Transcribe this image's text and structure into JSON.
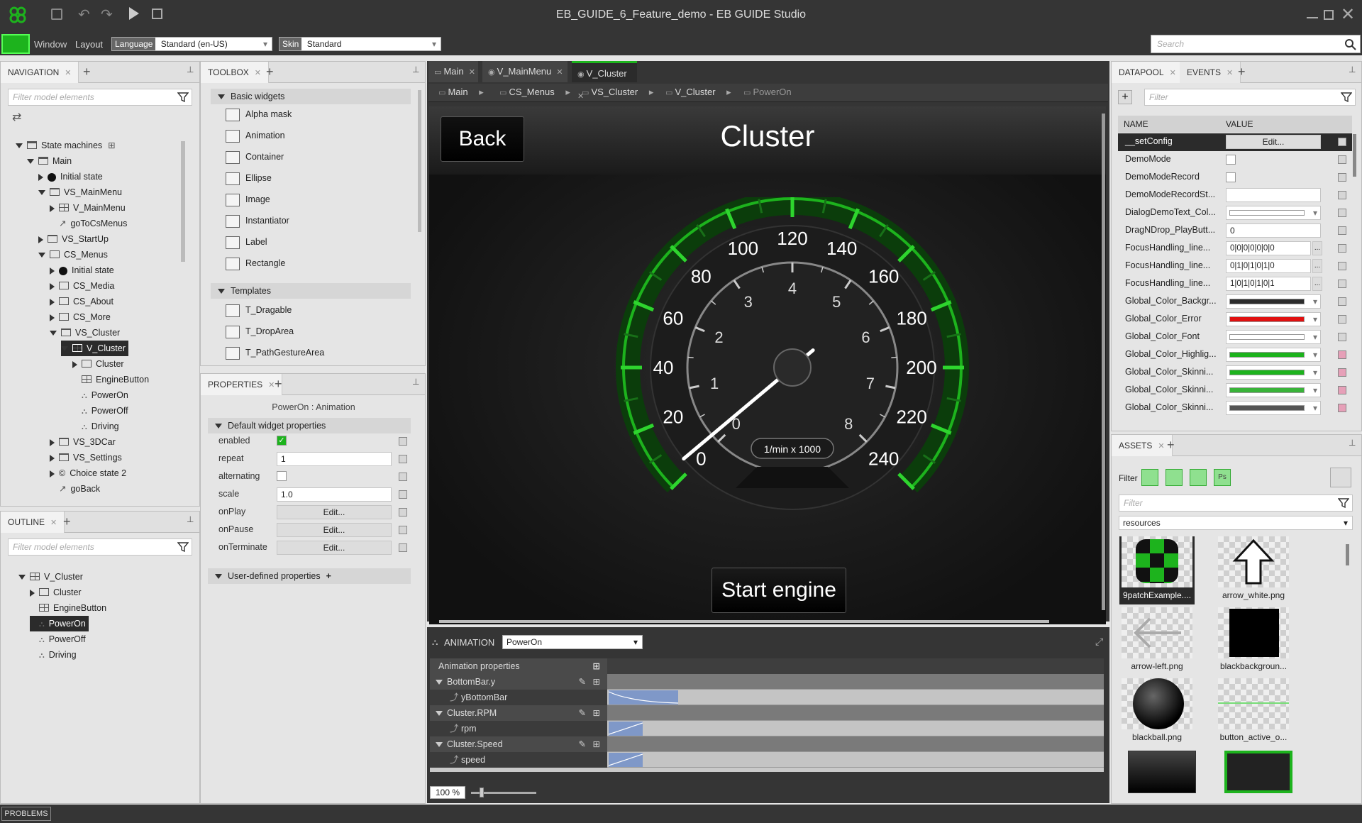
{
  "window": {
    "title": "EB_GUIDE_6_Feature_demo - EB GUIDE Studio"
  },
  "menubar": {
    "window": "Window",
    "layout": "Layout",
    "language_label": "Language",
    "language_value": "Standard (en-US)",
    "skin_label": "Skin",
    "skin_value": "Standard",
    "search_placeholder": "Search"
  },
  "navigation": {
    "tab": "NAVIGATION",
    "filter_placeholder": "Filter model elements",
    "items": [
      {
        "label": "State machines",
        "indent": 0,
        "arrow": "down",
        "icon": "statemachine"
      },
      {
        "label": "Main",
        "indent": 1,
        "arrow": "down",
        "icon": "statemachine"
      },
      {
        "label": "Initial state",
        "indent": 2,
        "arrow": "right",
        "icon": "dot"
      },
      {
        "label": "VS_MainMenu",
        "indent": 2,
        "arrow": "down",
        "icon": "view"
      },
      {
        "label": "V_MainMenu",
        "indent": 3,
        "arrow": "right",
        "icon": "grid"
      },
      {
        "label": "goToCsMenus",
        "indent": 3,
        "arrow": "none",
        "icon": "transition"
      },
      {
        "label": "VS_StartUp",
        "indent": 2,
        "arrow": "right",
        "icon": "view"
      },
      {
        "label": "CS_Menus",
        "indent": 2,
        "arrow": "down",
        "icon": "box"
      },
      {
        "label": "Initial state",
        "indent": 3,
        "arrow": "right",
        "icon": "dot"
      },
      {
        "label": "CS_Media",
        "indent": 3,
        "arrow": "right",
        "icon": "box"
      },
      {
        "label": "CS_About",
        "indent": 3,
        "arrow": "right",
        "icon": "box"
      },
      {
        "label": "CS_More",
        "indent": 3,
        "arrow": "right",
        "icon": "box"
      },
      {
        "label": "VS_Cluster",
        "indent": 3,
        "arrow": "down",
        "icon": "view"
      },
      {
        "label": "V_Cluster",
        "indent": 4,
        "arrow": "down",
        "icon": "grid",
        "selected": true
      },
      {
        "label": "Cluster",
        "indent": 5,
        "arrow": "right",
        "icon": "box"
      },
      {
        "label": "EngineButton",
        "indent": 5,
        "arrow": "none",
        "icon": "grid"
      },
      {
        "label": "PowerOn",
        "indent": 5,
        "arrow": "none",
        "icon": "anim"
      },
      {
        "label": "PowerOff",
        "indent": 5,
        "arrow": "none",
        "icon": "anim"
      },
      {
        "label": "Driving",
        "indent": 5,
        "arrow": "none",
        "icon": "anim"
      },
      {
        "label": "VS_3DCar",
        "indent": 3,
        "arrow": "right",
        "icon": "view"
      },
      {
        "label": "VS_Settings",
        "indent": 3,
        "arrow": "right",
        "icon": "view"
      },
      {
        "label": "Choice state 2",
        "indent": 3,
        "arrow": "right",
        "icon": "choice"
      },
      {
        "label": "goBack",
        "indent": 3,
        "arrow": "none",
        "icon": "transition"
      }
    ]
  },
  "outline": {
    "tab": "OUTLINE",
    "filter_placeholder": "Filter model elements",
    "items": [
      {
        "label": "V_Cluster",
        "indent": 0,
        "arrow": "down",
        "icon": "grid"
      },
      {
        "label": "Cluster",
        "indent": 1,
        "arrow": "right",
        "icon": "box"
      },
      {
        "label": "EngineButton",
        "indent": 1,
        "arrow": "none",
        "icon": "grid"
      },
      {
        "label": "PowerOn",
        "indent": 1,
        "arrow": "none",
        "icon": "anim",
        "selected": true
      },
      {
        "label": "PowerOff",
        "indent": 1,
        "arrow": "none",
        "icon": "anim"
      },
      {
        "label": "Driving",
        "indent": 1,
        "arrow": "none",
        "icon": "anim"
      }
    ]
  },
  "toolbox": {
    "tab": "TOOLBOX",
    "basic_header": "Basic widgets",
    "basic": [
      "Alpha mask",
      "Animation",
      "Container",
      "Ellipse",
      "Image",
      "Instantiator",
      "Label",
      "Rectangle"
    ],
    "templates_header": "Templates",
    "templates": [
      "T_Dragable",
      "T_DropArea",
      "T_PathGestureArea"
    ]
  },
  "properties": {
    "tab": "PROPERTIES",
    "subtitle": "PowerOn : Animation",
    "default_header": "Default widget properties",
    "rows": [
      {
        "name": "enabled",
        "type": "check",
        "checked": true,
        "value": ""
      },
      {
        "name": "repeat",
        "type": "text",
        "value": "1"
      },
      {
        "name": "alternating",
        "type": "check",
        "checked": false,
        "value": ""
      },
      {
        "name": "scale",
        "type": "text",
        "value": "1.0"
      },
      {
        "name": "onPlay",
        "type": "button",
        "value": "Edit..."
      },
      {
        "name": "onPause",
        "type": "button",
        "value": "Edit..."
      },
      {
        "name": "onTerminate",
        "type": "button",
        "value": "Edit..."
      }
    ],
    "user_header": "User-defined properties"
  },
  "editor": {
    "tabs": [
      "Main",
      "V_MainMenu",
      "V_Cluster"
    ],
    "breadcrumb": [
      "Main",
      "CS_Menus",
      "VS_Cluster",
      "V_Cluster",
      "PowerOn"
    ],
    "scene": {
      "back": "Back",
      "title": "Cluster",
      "start": "Start engine",
      "unit": "1/min x 1000",
      "speed_labels": [
        "0",
        "20",
        "40",
        "60",
        "80",
        "100",
        "120",
        "140",
        "160",
        "180",
        "200",
        "220",
        "240"
      ],
      "rpm_labels": [
        "0",
        "1",
        "2",
        "3",
        "4",
        "5",
        "6",
        "7",
        "8"
      ]
    }
  },
  "animation": {
    "label": "ANIMATION",
    "select": "PowerOn",
    "props_header": "Animation properties",
    "rows": [
      {
        "label": "BottomBar.y",
        "group": true
      },
      {
        "label": "yBottomBar",
        "group": false
      },
      {
        "label": "Cluster.RPM",
        "group": true
      },
      {
        "label": "rpm",
        "group": false
      },
      {
        "label": "Cluster.Speed",
        "group": true
      },
      {
        "label": "speed",
        "group": false
      }
    ],
    "zoom": "100 %"
  },
  "datapool": {
    "tabs": [
      "DATAPOOL",
      "EVENTS"
    ],
    "filter_placeholder": "Filter",
    "col_name": "NAME",
    "col_value": "VALUE",
    "rows": [
      {
        "name": "__setConfig",
        "type": "button",
        "value": "Edit...",
        "selected": true
      },
      {
        "name": "DemoMode",
        "type": "check",
        "value": ""
      },
      {
        "name": "DemoModeRecord",
        "type": "check",
        "value": ""
      },
      {
        "name": "DemoModeRecordSt...",
        "type": "text",
        "value": ""
      },
      {
        "name": "DialogDemoText_Col...",
        "type": "color",
        "value": "",
        "color": "#ffffff"
      },
      {
        "name": "DragNDrop_PlayButt...",
        "type": "text",
        "value": "0"
      },
      {
        "name": "FocusHandling_line...",
        "type": "list",
        "value": "0|0|0|0|0|0|0"
      },
      {
        "name": "FocusHandling_line...",
        "type": "list",
        "value": "0|1|0|1|0|1|0"
      },
      {
        "name": "FocusHandling_line...",
        "type": "list",
        "value": "1|0|1|0|1|0|1"
      },
      {
        "name": "Global_Color_Backgr...",
        "type": "color",
        "value": "",
        "color": "#2b2b2b"
      },
      {
        "name": "Global_Color_Error",
        "type": "color",
        "value": "",
        "color": "#e01010"
      },
      {
        "name": "Global_Color_Font",
        "type": "color",
        "value": "",
        "color": "#ffffff"
      },
      {
        "name": "Global_Color_Highlig...",
        "type": "color",
        "value": "",
        "color": "#1db31d"
      },
      {
        "name": "Global_Color_Skinni...",
        "type": "color",
        "value": "",
        "color": "#1db31d"
      },
      {
        "name": "Global_Color_Skinni...",
        "type": "color",
        "value": "",
        "color": "#39b339"
      },
      {
        "name": "Global_Color_Skinni...",
        "type": "color",
        "value": "",
        "color": "#555555"
      }
    ]
  },
  "assets": {
    "tab": "ASSETS",
    "filter_label": "Filter",
    "filter_placeholder": "Filter",
    "folder": "resources",
    "items": [
      "9patchExample....",
      "arrow_white.png",
      "arrow-left.png",
      "blackbackgroun...",
      "blackball.png",
      "button_active_o..."
    ]
  },
  "statusbar": {
    "problems": "PROBLEMS"
  },
  "colors": {
    "accent": "#1db31d",
    "dark": "#353535"
  }
}
